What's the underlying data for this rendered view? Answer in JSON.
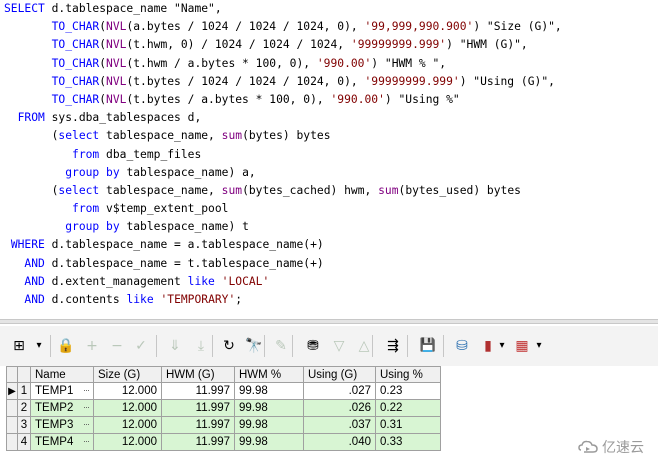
{
  "sql_editor": {
    "lines": [
      [
        [
          "kw",
          "SELECT"
        ],
        [
          "txt",
          " d.tablespace_name \"Name\","
        ]
      ],
      [
        [
          "txt",
          "       "
        ],
        [
          "kw",
          "TO_CHAR"
        ],
        [
          "sym",
          "("
        ],
        [
          "fn",
          "NVL"
        ],
        [
          "txt",
          "(a.bytes / 1024 / 1024 / 1024, 0), "
        ],
        [
          "str",
          "'99,999,990.900'"
        ],
        [
          "txt",
          ") \"Size (G)\","
        ]
      ],
      [
        [
          "txt",
          "       "
        ],
        [
          "kw",
          "TO_CHAR"
        ],
        [
          "sym",
          "("
        ],
        [
          "fn",
          "NVL"
        ],
        [
          "txt",
          "(t.hwm, 0) / 1024 / 1024 / 1024, "
        ],
        [
          "str",
          "'99999999.999'"
        ],
        [
          "txt",
          ") \"HWM (G)\","
        ]
      ],
      [
        [
          "txt",
          "       "
        ],
        [
          "kw",
          "TO_CHAR"
        ],
        [
          "sym",
          "("
        ],
        [
          "fn",
          "NVL"
        ],
        [
          "txt",
          "(t.hwm / a.bytes * 100, 0), "
        ],
        [
          "str",
          "'990.00'"
        ],
        [
          "txt",
          ") \"HWM % \","
        ]
      ],
      [
        [
          "txt",
          "       "
        ],
        [
          "kw",
          "TO_CHAR"
        ],
        [
          "sym",
          "("
        ],
        [
          "fn",
          "NVL"
        ],
        [
          "txt",
          "(t.bytes / 1024 / 1024 / 1024, 0), "
        ],
        [
          "str",
          "'99999999.999'"
        ],
        [
          "txt",
          ") \"Using (G)\","
        ]
      ],
      [
        [
          "txt",
          "       "
        ],
        [
          "kw",
          "TO_CHAR"
        ],
        [
          "sym",
          "("
        ],
        [
          "fn",
          "NVL"
        ],
        [
          "txt",
          "(t.bytes / a.bytes * 100, 0), "
        ],
        [
          "str",
          "'990.00'"
        ],
        [
          "txt",
          ") \"Using %\""
        ]
      ],
      [
        [
          "txt",
          "  "
        ],
        [
          "kw",
          "FROM"
        ],
        [
          "txt",
          " sys.dba_tablespaces d,"
        ]
      ],
      [
        [
          "txt",
          "       ("
        ],
        [
          "kw",
          "select"
        ],
        [
          "txt",
          " tablespace_name, "
        ],
        [
          "fn",
          "sum"
        ],
        [
          "txt",
          "(bytes) bytes"
        ]
      ],
      [
        [
          "txt",
          "          "
        ],
        [
          "kw",
          "from"
        ],
        [
          "txt",
          " dba_temp_files"
        ]
      ],
      [
        [
          "txt",
          "         "
        ],
        [
          "kw",
          "group by"
        ],
        [
          "txt",
          " tablespace_name) a,"
        ]
      ],
      [
        [
          "txt",
          "       ("
        ],
        [
          "kw",
          "select"
        ],
        [
          "txt",
          " tablespace_name, "
        ],
        [
          "fn",
          "sum"
        ],
        [
          "txt",
          "(bytes_cached) hwm, "
        ],
        [
          "fn",
          "sum"
        ],
        [
          "txt",
          "(bytes_used) bytes"
        ]
      ],
      [
        [
          "txt",
          "          "
        ],
        [
          "kw",
          "from"
        ],
        [
          "txt",
          " v$temp_extent_pool"
        ]
      ],
      [
        [
          "txt",
          "         "
        ],
        [
          "kw",
          "group by"
        ],
        [
          "txt",
          " tablespace_name) t"
        ]
      ],
      [
        [
          "txt",
          " "
        ],
        [
          "kw",
          "WHERE"
        ],
        [
          "txt",
          " d.tablespace_name = a.tablespace_name(+)"
        ]
      ],
      [
        [
          "txt",
          "   "
        ],
        [
          "kw",
          "AND"
        ],
        [
          "txt",
          " d.tablespace_name = t.tablespace_name(+)"
        ]
      ],
      [
        [
          "txt",
          "   "
        ],
        [
          "kw",
          "AND"
        ],
        [
          "txt",
          " d.extent_management "
        ],
        [
          "kw",
          "like"
        ],
        [
          "txt",
          " "
        ],
        [
          "str",
          "'LOCAL'"
        ]
      ],
      [
        [
          "txt",
          "   "
        ],
        [
          "kw",
          "AND"
        ],
        [
          "txt",
          " d.contents "
        ],
        [
          "kw",
          "like"
        ],
        [
          "txt",
          " "
        ],
        [
          "str",
          "'TEMPORARY'"
        ],
        [
          "txt",
          ";"
        ]
      ]
    ]
  },
  "toolbar": {
    "icons": [
      {
        "name": "grid-view-icon",
        "glyph": "⊞",
        "enabled": true
      },
      {
        "name": "dropdown-arrow-icon",
        "glyph": "▾",
        "enabled": true
      },
      {
        "name": "lock-icon",
        "glyph": "🔒",
        "enabled": true
      },
      {
        "name": "add-record-icon",
        "glyph": "+",
        "enabled": false
      },
      {
        "name": "delete-record-icon",
        "glyph": "−",
        "enabled": false
      },
      {
        "name": "post-changes-icon",
        "glyph": "✓",
        "enabled": false
      },
      {
        "name": "fetch-next-icon",
        "glyph": "⇓",
        "enabled": false
      },
      {
        "name": "fetch-last-icon",
        "glyph": "⤓",
        "enabled": false
      },
      {
        "name": "refresh-icon",
        "glyph": "↻",
        "enabled": true
      },
      {
        "name": "find-icon",
        "glyph": "🔭",
        "enabled": true
      },
      {
        "name": "clear-icon",
        "glyph": "✎",
        "enabled": false
      },
      {
        "name": "query-by-example-icon",
        "glyph": "⛃",
        "enabled": true
      },
      {
        "name": "sort-down-icon",
        "glyph": "▽",
        "enabled": false
      },
      {
        "name": "sort-up-icon",
        "glyph": "△",
        "enabled": false
      },
      {
        "name": "export-icon",
        "glyph": "⇶",
        "enabled": true
      },
      {
        "name": "save-icon",
        "glyph": "💾",
        "enabled": true
      },
      {
        "name": "database-icon",
        "glyph": "⛁",
        "enabled": true
      },
      {
        "name": "chart-icon",
        "glyph": "▮",
        "enabled": true
      },
      {
        "name": "chart-dropdown-icon",
        "glyph": "▾",
        "enabled": true
      },
      {
        "name": "table-options-icon",
        "glyph": "▦",
        "enabled": true
      },
      {
        "name": "table-dropdown-icon",
        "glyph": "▾",
        "enabled": true
      }
    ]
  },
  "result_grid": {
    "columns": [
      "Name",
      "Size (G)",
      "HWM (G)",
      "HWM %",
      "Using (G)",
      "Using %"
    ],
    "rows": [
      {
        "rn": "1",
        "cells": [
          "TEMP1",
          "12.000",
          "11.997",
          "99.98",
          ".027",
          "0.23"
        ]
      },
      {
        "rn": "2",
        "cells": [
          "TEMP2",
          "12.000",
          "11.997",
          "99.98",
          ".026",
          "0.22"
        ]
      },
      {
        "rn": "3",
        "cells": [
          "TEMP3",
          "12.000",
          "11.997",
          "99.98",
          ".037",
          "0.31"
        ]
      },
      {
        "rn": "4",
        "cells": [
          "TEMP4",
          "12.000",
          "11.997",
          "99.98",
          ".040",
          "0.33"
        ]
      }
    ],
    "current_row_marker": "▶",
    "ellipsis": "···"
  },
  "watermark": {
    "text": "亿速云"
  },
  "colors": {
    "keyword": "#0000ff",
    "function": "#800080",
    "string": "#800000",
    "alt_row": "#d8f5d3"
  }
}
